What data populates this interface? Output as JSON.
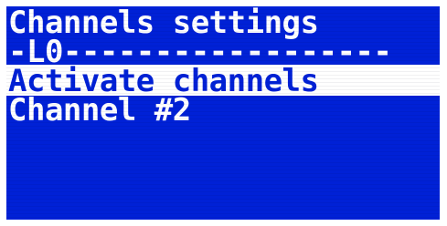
{
  "screen": {
    "title": "Channels settings",
    "header": "-L0------------------",
    "menu": {
      "items": [
        {
          "label": "Activate channels",
          "selected": true
        },
        {
          "label": "Channel #2",
          "selected": false
        }
      ]
    },
    "colors": {
      "background": "#0021d6",
      "foreground": "#ffffff",
      "frame": "#ffffff"
    }
  }
}
